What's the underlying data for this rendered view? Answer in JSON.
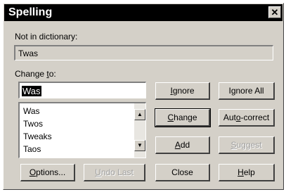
{
  "window": {
    "title": "Spelling",
    "close_glyph": "✕"
  },
  "not_in_dictionary": {
    "label": "Not in dictionary:",
    "value": "Twas"
  },
  "change_to": {
    "label_prefix": "Change ",
    "label_accel": "t",
    "label_suffix": "o:",
    "value": "Was"
  },
  "suggestions": {
    "items": [
      "Was",
      "Twos",
      "Tweaks",
      "Taos"
    ],
    "scroll_up_icon": "scroll-up-arrow",
    "scroll_down_icon": "scroll-down-arrow"
  },
  "buttons": {
    "ignore": {
      "accel": "I",
      "rest": "gnore"
    },
    "ignore_all": {
      "pre": "I",
      "accel": "g",
      "rest": "nore All"
    },
    "change": {
      "accel": "C",
      "rest": "hange"
    },
    "auto_correct": {
      "pre": "Aut",
      "accel": "o",
      "rest": "-correct"
    },
    "add": {
      "accel": "A",
      "rest": "dd"
    },
    "suggest": {
      "pre": "",
      "accel": "S",
      "rest": "uggest"
    },
    "options": {
      "accel": "O",
      "rest": "ptions..."
    },
    "undo_last": {
      "accel": "U",
      "rest": "ndo Last"
    },
    "close": {
      "label": "Close"
    },
    "help": {
      "accel": "H",
      "rest": "elp"
    }
  }
}
